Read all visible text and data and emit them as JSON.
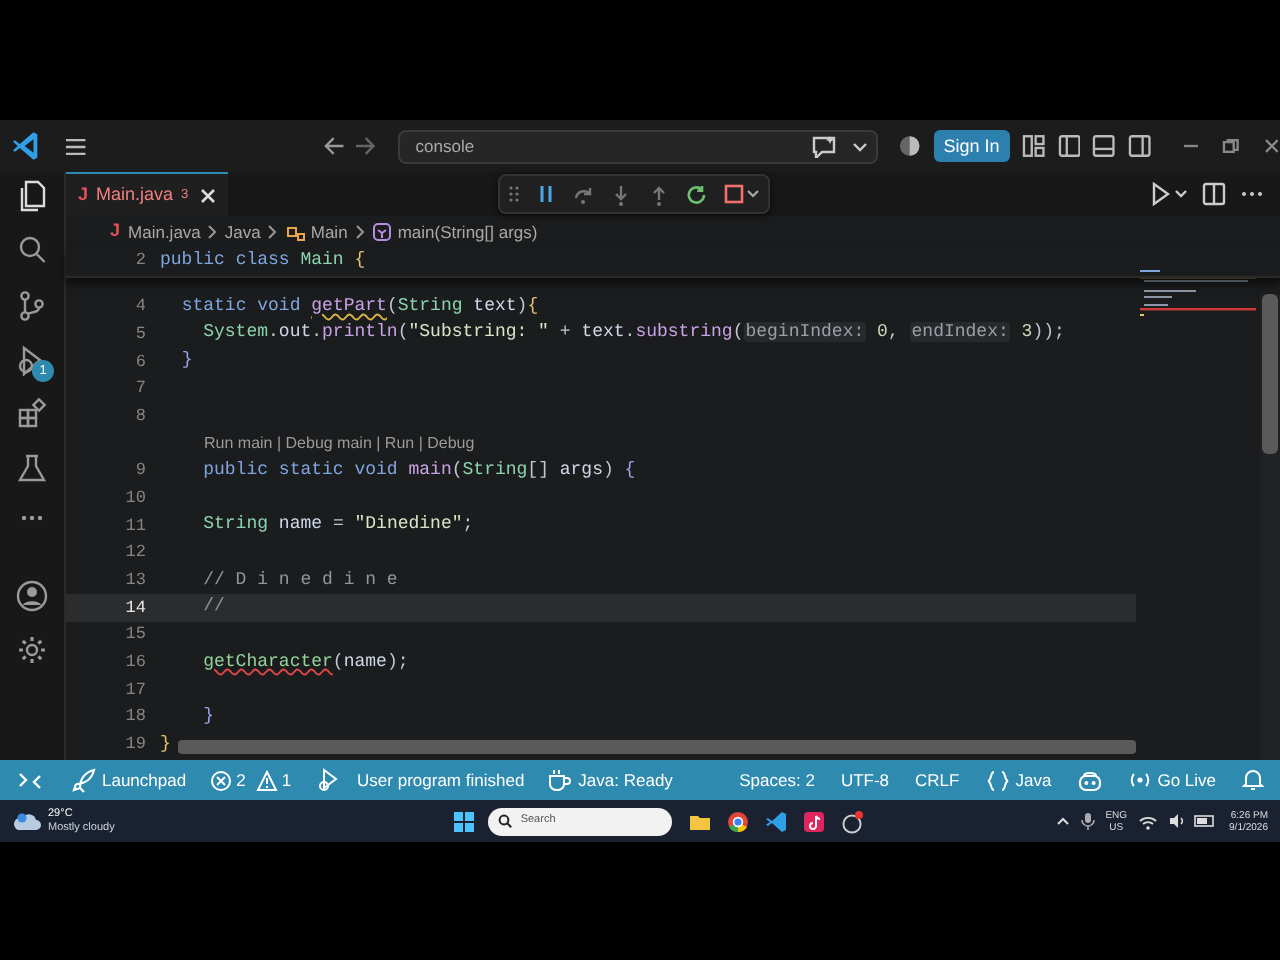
{
  "title_bar": {
    "command_center": "console",
    "sign_in": "Sign In"
  },
  "activity_bar": {
    "debug_badge": "1"
  },
  "tabs": [
    {
      "file_icon": "J",
      "label": "Main.java",
      "problems": "3",
      "selected": true
    }
  ],
  "breadcrumb": [
    {
      "kind": "file",
      "icon": "J",
      "label": "Main.java"
    },
    {
      "kind": "folder",
      "label": "Java"
    },
    {
      "kind": "class",
      "label": "Main"
    },
    {
      "kind": "method",
      "label": "main(String[] args)"
    }
  ],
  "sticky_lines": [
    {
      "number": "2",
      "current": false,
      "tokens": [
        {
          "kind": "kw",
          "text": "public "
        },
        {
          "kind": "kw",
          "text": "class "
        },
        {
          "kind": "type",
          "text": "Main "
        },
        {
          "kind": "brace",
          "text": "{"
        }
      ]
    }
  ],
  "code_lines": [
    {
      "kind": "code",
      "number": "4",
      "current": false,
      "tokens": [
        {
          "kind": "kw",
          "text": "  static "
        },
        {
          "kind": "kw",
          "text": "void "
        },
        {
          "kind": "fn_warning",
          "text": "getPart"
        },
        {
          "kind": "p",
          "text": "("
        },
        {
          "kind": "type",
          "text": "String "
        },
        {
          "kind": "var",
          "text": "text"
        },
        {
          "kind": "p",
          "text": ")"
        },
        {
          "kind": "brace",
          "text": "{"
        }
      ]
    },
    {
      "kind": "code",
      "number": "5",
      "current": false,
      "tokens": [
        {
          "kind": "type",
          "text": "    System"
        },
        {
          "kind": "p",
          "text": "."
        },
        {
          "kind": "var",
          "text": "out"
        },
        {
          "kind": "p",
          "text": "."
        },
        {
          "kind": "fn",
          "text": "println"
        },
        {
          "kind": "p",
          "text": "("
        },
        {
          "kind": "str",
          "text": "\"Substring: \""
        },
        {
          "kind": "p",
          "text": " + "
        },
        {
          "kind": "var",
          "text": "text"
        },
        {
          "kind": "p",
          "text": "."
        },
        {
          "kind": "fn",
          "text": "substring"
        },
        {
          "kind": "p",
          "text": "("
        },
        {
          "kind": "hint",
          "text": "beginIndex:"
        },
        {
          "kind": "num",
          "text": " 0"
        },
        {
          "kind": "p",
          "text": ", "
        },
        {
          "kind": "hint",
          "text": "endIndex:"
        },
        {
          "kind": "num",
          "text": " 3"
        },
        {
          "kind": "p",
          "text": "));"
        }
      ]
    },
    {
      "kind": "code",
      "number": "6",
      "current": false,
      "tokens": [
        {
          "kind": "brace2",
          "text": "  }"
        }
      ]
    },
    {
      "kind": "code",
      "number": "7",
      "current": false
    },
    {
      "kind": "code",
      "number": "8",
      "current": false
    },
    {
      "kind": "lens",
      "text": "Run main | Debug main | Run | Debug"
    },
    {
      "kind": "code",
      "number": "9",
      "current": false,
      "tokens": [
        {
          "kind": "kw",
          "text": "    public "
        },
        {
          "kind": "kw",
          "text": "static "
        },
        {
          "kind": "kw",
          "text": "void "
        },
        {
          "kind": "fn",
          "text": "main"
        },
        {
          "kind": "p",
          "text": "("
        },
        {
          "kind": "type",
          "text": "String"
        },
        {
          "kind": "p",
          "text": "[] "
        },
        {
          "kind": "var",
          "text": "args"
        },
        {
          "kind": "p",
          "text": ") "
        },
        {
          "kind": "brace2",
          "text": "{"
        }
      ]
    },
    {
      "kind": "code",
      "number": "10",
      "current": false
    },
    {
      "kind": "code",
      "number": "11",
      "current": false,
      "tokens": [
        {
          "kind": "type",
          "text": "    String "
        },
        {
          "kind": "var",
          "text": "name"
        },
        {
          "kind": "p",
          "text": " = "
        },
        {
          "kind": "str",
          "text": "\"Dinedine\""
        },
        {
          "kind": "p",
          "text": ";"
        }
      ]
    },
    {
      "kind": "code",
      "number": "12",
      "current": false
    },
    {
      "kind": "code",
      "number": "13",
      "current": false,
      "tokens": [
        {
          "kind": "comment",
          "text": "    // D i n e d i n e"
        }
      ]
    },
    {
      "kind": "code",
      "number": "14",
      "current": true,
      "tokens": [
        {
          "kind": "comment",
          "text": "    //"
        }
      ]
    },
    {
      "kind": "code",
      "number": "15",
      "current": false
    },
    {
      "kind": "code",
      "number": "16",
      "current": false,
      "tokens": [
        {
          "kind": "fn2_error",
          "text": "    getCharacter"
        },
        {
          "kind": "p",
          "text": "("
        },
        {
          "kind": "var",
          "text": "name"
        },
        {
          "kind": "p",
          "text": ");"
        }
      ]
    },
    {
      "kind": "code",
      "number": "17",
      "current": false
    },
    {
      "kind": "code",
      "number": "18",
      "current": false,
      "tokens": [
        {
          "kind": "brace2",
          "text": "    }"
        }
      ]
    },
    {
      "kind": "code",
      "number": "19",
      "current": false,
      "tokens": [
        {
          "kind": "brace",
          "text": "}"
        }
      ]
    }
  ],
  "status_bar": {
    "left": [
      {
        "kind": "remote"
      },
      {
        "kind": "launchpad",
        "label": "Launchpad"
      },
      {
        "kind": "problems",
        "errors": "2",
        "warnings": "1"
      },
      {
        "kind": "debug",
        "label": "User program finished"
      },
      {
        "kind": "java",
        "label": "Java: Ready"
      }
    ],
    "right": [
      {
        "kind": "text",
        "label": "Spaces: 2"
      },
      {
        "kind": "text",
        "label": "UTF-8"
      },
      {
        "kind": "text",
        "label": "CRLF"
      },
      {
        "kind": "language",
        "label": "Java"
      },
      {
        "kind": "copilot"
      },
      {
        "kind": "live",
        "label": "Go Live"
      },
      {
        "kind": "bell"
      }
    ]
  },
  "taskbar": {
    "temperature": "29°C",
    "weather": "Mostly cloudy",
    "search_placeholder": "Search",
    "language": "ENG",
    "region": "US",
    "time": "6:26 PM",
    "date": "9/1/2026"
  }
}
